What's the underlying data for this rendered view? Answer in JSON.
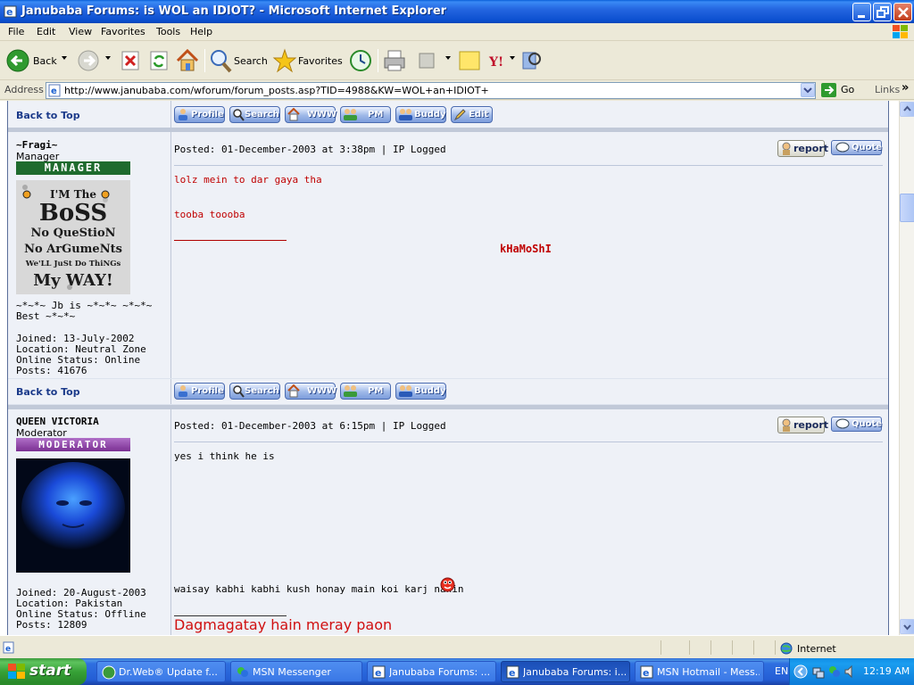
{
  "window": {
    "title": "Janubaba Forums: is WOL an IDIOT? - Microsoft Internet Explorer"
  },
  "menu": [
    "File",
    "Edit",
    "View",
    "Favorites",
    "Tools",
    "Help"
  ],
  "toolbar": {
    "back_label": "Back",
    "search_label": "Search",
    "favorites_label": "Favorites"
  },
  "address": {
    "label": "Address",
    "url": "http://www.janubaba.com/wforum/forum_posts.asp?TID=4988&KW=WOL+an+IDIOT+",
    "go_label": "Go",
    "links_label": "Links"
  },
  "forum": {
    "back_to_top": "Back to Top",
    "buttons": {
      "profile": "Profile",
      "search": "Search",
      "www": "WWW",
      "pm": "PM",
      "buddy": "Buddy",
      "edit": "Edit",
      "report": "report",
      "quote": "Quote"
    },
    "posts": [
      {
        "author": "~Fragi~",
        "role": "Manager",
        "rank_badge": "MANAGER",
        "avatar_text": [
          "I'M The",
          "BoSS",
          "No QueStioN",
          "No ArGumeNts",
          "We'LL JuSt Do ThiNGs",
          "My WAY!"
        ],
        "tagline": "~*~*~ Jb is ~*~*~ ~*~*~\nBest ~*~*~",
        "joined": "Joined: 13-July-2002",
        "location": "Location: Neutral Zone",
        "status": "Online Status: Online",
        "posts": "Posts: 41676",
        "posted": "Posted: 01-December-2003 at 3:38pm | IP Logged",
        "lines": [
          "lolz mein to dar gaya tha",
          "tooba toooba"
        ],
        "signature": "kHaMoShI"
      },
      {
        "author": "QUEEN VICTORIA",
        "role": "Moderator",
        "rank_badge": "MODERATOR",
        "joined": "Joined: 20-August-2003",
        "location": "Location: Pakistan",
        "status": "Online Status: Offline",
        "posts": "Posts: 12809",
        "posted": "Posted: 01-December-2003 at 6:15pm | IP Logged",
        "lines": [
          "yes i think he is",
          "waisay kabhi kabhi kush honay main koi karj nahin"
        ],
        "signature": "Dagmagatay hain meray paon"
      }
    ]
  },
  "statusbar": {
    "zone": "Internet"
  },
  "taskbar": {
    "start_label": "start",
    "tasks": [
      "Dr.Web® Update f...",
      "MSN Messenger",
      "Janubaba Forums: ...",
      "Janubaba Forums: i...",
      "MSN Hotmail - Mess..."
    ],
    "language": "EN",
    "clock": "12:19 AM"
  },
  "colors": {
    "title_blue": "#2466e0",
    "post_red": "#c00000",
    "manager_badge": "#1f6b2e",
    "moderator_badge": "#8a3fa0",
    "taskbar_blue": "#245ed5",
    "start_green": "#37a137"
  }
}
